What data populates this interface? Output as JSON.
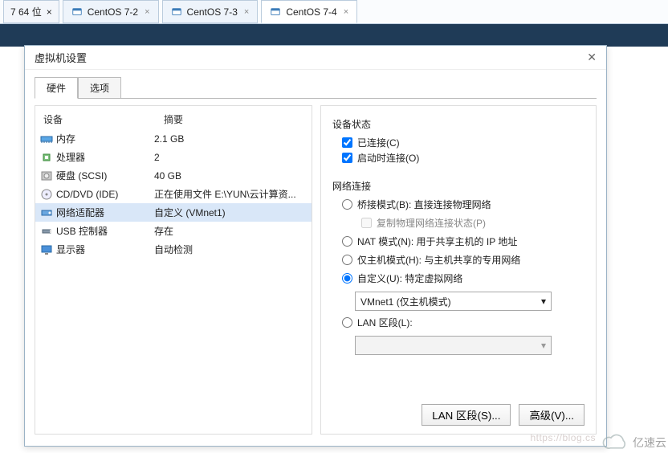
{
  "tabs": {
    "bit_tab": "7 64 位",
    "vm": [
      {
        "label": "CentOS 7-2",
        "active": false
      },
      {
        "label": "CentOS 7-3",
        "active": false
      },
      {
        "label": "CentOS 7-4",
        "active": true
      }
    ]
  },
  "dialog": {
    "title": "虚拟机设置",
    "tabs": {
      "hardware": "硬件",
      "options": "选项"
    },
    "hw_header": {
      "device": "设备",
      "summary": "摘要"
    },
    "hw_rows": [
      {
        "icon": "memory",
        "label": "内存",
        "summary": "2.1 GB"
      },
      {
        "icon": "cpu",
        "label": "处理器",
        "summary": "2"
      },
      {
        "icon": "disk",
        "label": "硬盘 (SCSI)",
        "summary": "40 GB"
      },
      {
        "icon": "cd",
        "label": "CD/DVD (IDE)",
        "summary": "正在使用文件 E:\\YUN\\云计算资..."
      },
      {
        "icon": "nic",
        "label": "网络适配器",
        "summary": "自定义 (VMnet1)"
      },
      {
        "icon": "usb",
        "label": "USB 控制器",
        "summary": "存在"
      },
      {
        "icon": "display",
        "label": "显示器",
        "summary": "自动检测"
      }
    ],
    "right": {
      "device_status": "设备状态",
      "connected": "已连接(C)",
      "connect_at_power": "启动时连接(O)",
      "net_conn": "网络连接",
      "bridged": "桥接模式(B): 直接连接物理网络",
      "replicate": "复制物理网络连接状态(P)",
      "nat": "NAT 模式(N): 用于共享主机的 IP 地址",
      "hostonly": "仅主机模式(H): 与主机共享的专用网络",
      "custom": "自定义(U): 特定虚拟网络",
      "custom_sel": "VMnet1 (仅主机模式)",
      "lan": "LAN 区段(L):",
      "btn_lan": "LAN 区段(S)...",
      "btn_adv": "高级(V)..."
    }
  },
  "watermark": "亿速云",
  "faint": "https://blog.cs"
}
